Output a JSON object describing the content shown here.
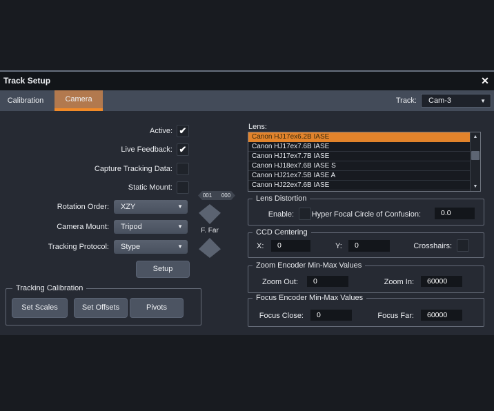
{
  "window": {
    "title": "Track Setup"
  },
  "icons": {
    "close": "✕",
    "check": "✔",
    "dropdown": "▼",
    "scroll_up": "▲",
    "scroll_down": "▼"
  },
  "colors": {
    "accent_orange": "#f18a28",
    "tab_active_bg": "#b2794e",
    "selected_row_bg": "#e2832b",
    "dialog_bg": "#262a33"
  },
  "tabs": [
    {
      "label": "Calibration",
      "active": false
    },
    {
      "label": "Camera",
      "active": true
    }
  ],
  "track": {
    "label": "Track:",
    "value": "Cam-3"
  },
  "left_panel": {
    "checkboxes": [
      {
        "label": "Active:",
        "checked": true
      },
      {
        "label": "Live Feedback:",
        "checked": true
      },
      {
        "label": "Capture Tracking Data:",
        "checked": false
      },
      {
        "label": "Static Mount:",
        "checked": false
      }
    ],
    "badges": [
      "001",
      "000"
    ],
    "dropdowns": [
      {
        "label": "Rotation Order:",
        "value": "XZY"
      },
      {
        "label": "Camera Mount:",
        "value": "Tripod"
      },
      {
        "label": "Tracking Protocol:",
        "value": "Stype"
      }
    ],
    "setup_button": "Setup",
    "f_far": "F. Far",
    "tracking_calibration": {
      "title": "Tracking Calibration",
      "buttons": [
        "Set Scales",
        "Set Offsets",
        "Pivots"
      ]
    }
  },
  "right_panel": {
    "lens": {
      "label": "Lens:",
      "items": [
        {
          "label": "Canon HJ17ex6.2B IASE",
          "selected": true
        },
        {
          "label": "Canon HJ17ex7.6B IASE",
          "selected": false
        },
        {
          "label": "Canon HJ17ex7.7B IASE",
          "selected": false
        },
        {
          "label": "Canon HJ18ex7.6B IASE S",
          "selected": false
        },
        {
          "label": "Canon HJ21ex7.5B IASE A",
          "selected": false
        },
        {
          "label": "Canon HJ22ex7.6B IASE",
          "selected": false
        }
      ]
    },
    "lens_distortion": {
      "title": "Lens Distortion",
      "enable_label": "Enable:",
      "enable_checked": false,
      "hyper_focal_label": "Hyper Focal Circle of Confusion:",
      "hyper_focal_value": "0.0"
    },
    "ccd_centering": {
      "title": "CCD Centering",
      "x_label": "X:",
      "x_value": "0",
      "y_label": "Y:",
      "y_value": "0",
      "crosshairs_label": "Crosshairs:",
      "crosshairs_checked": false
    },
    "zoom_encoder": {
      "title": "Zoom Encoder Min-Max Values",
      "zoom_out_label": "Zoom Out:",
      "zoom_out_value": "0",
      "zoom_in_label": "Zoom In:",
      "zoom_in_value": "60000"
    },
    "focus_encoder": {
      "title": "Focus Encoder Min-Max Values",
      "focus_close_label": "Focus Close:",
      "focus_close_value": "0",
      "focus_far_label": "Focus Far:",
      "focus_far_value": "60000"
    }
  }
}
